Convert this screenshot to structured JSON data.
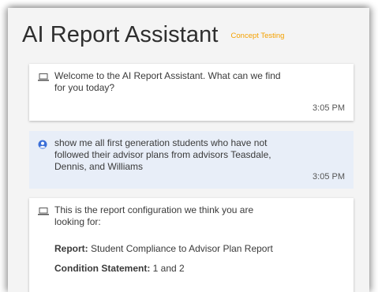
{
  "header": {
    "title": "AI Report Assistant",
    "badge": "Concept Testing"
  },
  "messages": [
    {
      "sender": "assistant",
      "icon": "laptop-icon",
      "text": "Welcome to the AI Report Assistant. What can we find for you today?",
      "time": "3:05 PM"
    },
    {
      "sender": "user",
      "icon": "user-circle-icon",
      "text": "show me all first generation students who have not followed their advisor plans from advisors Teasdale, Dennis, and Williams",
      "time": "3:05 PM"
    },
    {
      "sender": "assistant",
      "icon": "laptop-icon",
      "intro": "This is the report configuration we think you are looking for:",
      "fields": [
        {
          "label": "Report:",
          "value": "Student Compliance to Advisor Plan Report"
        },
        {
          "label": "Condition Statement:",
          "value": "1 and 2"
        }
      ]
    }
  ],
  "colors": {
    "accent": "#f5a100",
    "user_bubble": "#e8eef8",
    "user_icon": "#3b6fd8"
  }
}
